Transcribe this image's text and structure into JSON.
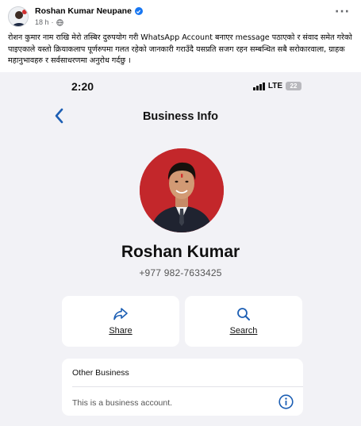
{
  "post": {
    "author": "Roshan Kumar Neupane",
    "time": "18 h",
    "separator": "·",
    "more": "···",
    "text": "रोशन कुमार नाम राखि मेरो तस्बिर दुरुपयोग गरी WhatsApp Account बनाएर message पठाएको र संवाद समेत गरेको पाइएकाले यस्तो क्रियाकलाप पूर्णरुपमा गलत रहेको जानकारी गराउँदै यसप्रति सजग रहन सम्बन्धित सबै सरोकारवाला, ग्राहक महानुभावहरु र सर्वसाधरणमा अनुरोध गर्दछु ।"
  },
  "screenshot": {
    "status_bar": {
      "time": "2:20",
      "network": "LTE",
      "battery": "22"
    },
    "nav": {
      "title": "Business Info"
    },
    "profile": {
      "name": "Roshan Kumar",
      "phone": "+977 982-7633425"
    },
    "actions": [
      {
        "label": "Share",
        "icon": "share-icon"
      },
      {
        "label": "Search",
        "icon": "search-icon"
      }
    ],
    "info": {
      "title": "Other Business",
      "description": "This is a business account."
    },
    "colors": {
      "accent": "#1d5fb4",
      "photo_background": "#c3272b",
      "verified": "#1877f2"
    }
  }
}
